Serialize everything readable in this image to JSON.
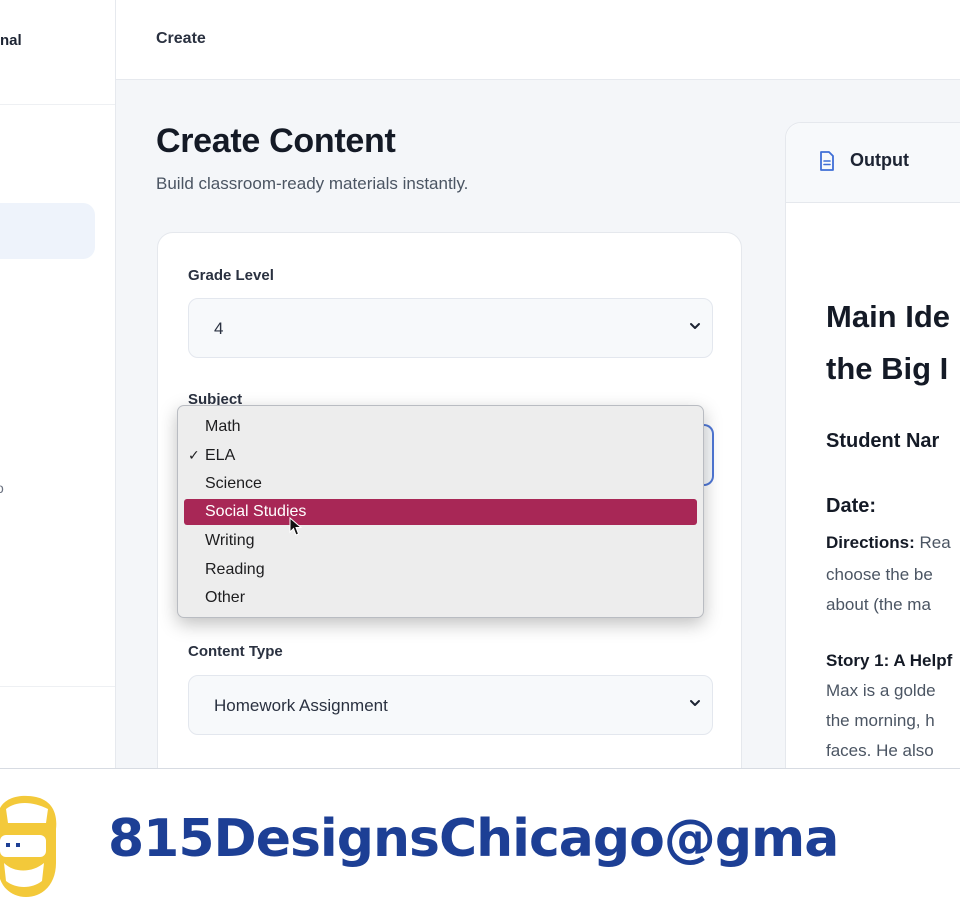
{
  "sidebar": {
    "brand_fragment": "nal",
    "tiny_fragment": "o"
  },
  "topbar": {
    "breadcrumb": "Create"
  },
  "page": {
    "title": "Create Content",
    "subtitle": "Build classroom-ready materials instantly."
  },
  "form": {
    "grade": {
      "label": "Grade Level",
      "value": "4"
    },
    "subject": {
      "label": "Subject",
      "options": [
        {
          "label": "Math",
          "checked": false,
          "highlighted": false
        },
        {
          "label": "ELA",
          "checked": true,
          "highlighted": false
        },
        {
          "label": "Science",
          "checked": false,
          "highlighted": false
        },
        {
          "label": "Social Studies",
          "checked": false,
          "highlighted": true
        },
        {
          "label": "Writing",
          "checked": false,
          "highlighted": false
        },
        {
          "label": "Reading",
          "checked": false,
          "highlighted": false
        },
        {
          "label": "Other",
          "checked": false,
          "highlighted": false
        }
      ]
    },
    "content_type": {
      "label": "Content Type",
      "value": "Homework Assignment"
    }
  },
  "output": {
    "header": "Output",
    "heading_line1": "Main Ide",
    "heading_line2": "the Big I",
    "student_name": "Student Nar",
    "date": "Date:",
    "directions_label": "Directions:",
    "directions_text_1": " Rea",
    "directions_text_2": "choose the be",
    "directions_text_3": "about (the ma",
    "story_title": "Story 1: A Helpf",
    "story_line_1": "Max is a golde",
    "story_line_2": "the morning, h",
    "story_line_3": "faces. He also"
  },
  "banner": {
    "email": "815DesignsChicago@gma"
  },
  "colors": {
    "highlight": "#a82756",
    "focus_ring": "#4f77d6",
    "banner_text": "#1d3f95",
    "logo_yellow": "#f3c93a"
  },
  "icons": [
    "chevron-down-icon",
    "check-icon",
    "document-icon",
    "mouse-cursor-icon",
    "logo-icon"
  ]
}
